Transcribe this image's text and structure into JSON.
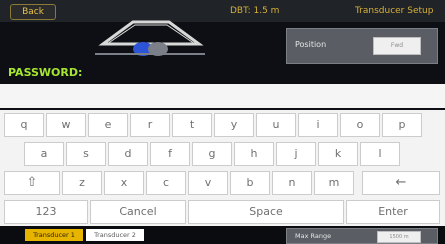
{
  "topbar": {
    "back_label": "Back",
    "dbt_readout": "DBT: 1.5 m",
    "screen_title": "Transducer Setup"
  },
  "settings": {
    "position_label": "Position",
    "position_value": "Fwd"
  },
  "password": {
    "label": "PASSWORD:",
    "value": ""
  },
  "keyboard": {
    "row1": [
      "q",
      "w",
      "e",
      "r",
      "t",
      "y",
      "u",
      "i",
      "o",
      "p"
    ],
    "row2": [
      "a",
      "s",
      "d",
      "f",
      "g",
      "h",
      "j",
      "k",
      "l"
    ],
    "row3": [
      "z",
      "x",
      "c",
      "v",
      "b",
      "n",
      "m"
    ],
    "shift_symbol": "⇧",
    "backspace_symbol": "←",
    "numbers_label": "123",
    "cancel_label": "Cancel",
    "space_label": "Space",
    "enter_label": "Enter"
  },
  "bottom": {
    "tabs": [
      "Transducer 1",
      "Transducer 2"
    ],
    "max_range_label": "Max Range",
    "max_range_value": "1500 m"
  },
  "colors": {
    "accent": "#d6b03a",
    "green_label": "#a6e632"
  }
}
